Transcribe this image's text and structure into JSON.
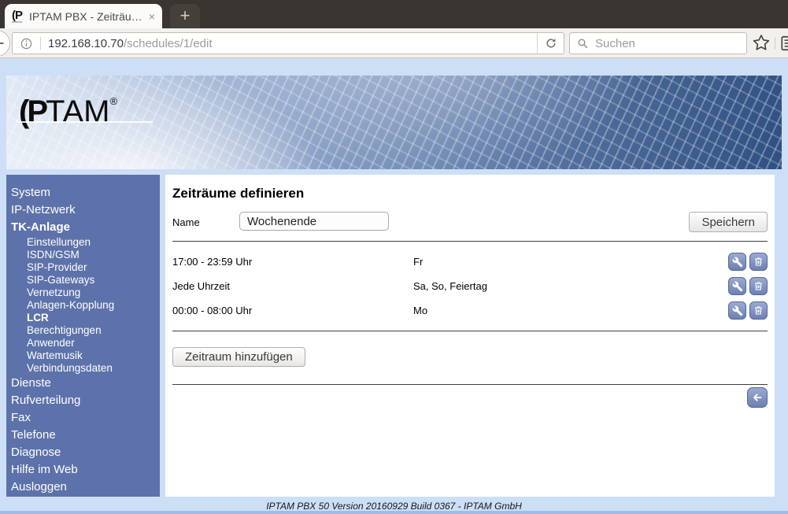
{
  "browser": {
    "tab": {
      "favicon_text": "(P",
      "title": "IPTAM PBX - Zeiträu…",
      "close_glyph": "×",
      "new_tab_glyph": "+"
    },
    "url": {
      "host": "192.168.10.70",
      "path": "/schedules/1/edit"
    },
    "search": {
      "placeholder": "Suchen"
    }
  },
  "banner": {
    "logo_prefix": "(P",
    "logo_rest": "TAM",
    "logo_reg": "®"
  },
  "sidebar": {
    "items": [
      {
        "label": "System",
        "css": "top"
      },
      {
        "label": "IP-Netzwerk",
        "css": "top"
      },
      {
        "label": "TK-Anlage",
        "css": "top bold"
      },
      {
        "label": "Einstellungen",
        "css": "sub"
      },
      {
        "label": "ISDN/GSM",
        "css": "sub"
      },
      {
        "label": "SIP-Provider",
        "css": "sub"
      },
      {
        "label": "SIP-Gateways",
        "css": "sub"
      },
      {
        "label": "Vernetzung",
        "css": "sub"
      },
      {
        "label": "Anlagen-Kopplung",
        "css": "sub"
      },
      {
        "label": "LCR",
        "css": "sub bold"
      },
      {
        "label": "Berechtigungen",
        "css": "sub"
      },
      {
        "label": "Anwender",
        "css": "sub"
      },
      {
        "label": "Wartemusik",
        "css": "sub"
      },
      {
        "label": "Verbindungsdaten",
        "css": "sub"
      },
      {
        "label": "Dienste",
        "css": "top"
      },
      {
        "label": "Rufverteilung",
        "css": "top"
      },
      {
        "label": "Fax",
        "css": "top"
      },
      {
        "label": "Telefone",
        "css": "top"
      },
      {
        "label": "Diagnose",
        "css": "top"
      },
      {
        "label": "Hilfe im Web",
        "css": "top"
      },
      {
        "label": "Ausloggen",
        "css": "top"
      }
    ]
  },
  "main": {
    "title": "Zeiträume definieren",
    "name_label": "Name",
    "name_value": "Wochenende",
    "save_button": "Speichern",
    "add_button": "Zeitraum hinzufügen",
    "rows": [
      {
        "time": "17:00 - 23:59 Uhr",
        "days": "Fr"
      },
      {
        "time": "Jede Uhrzeit",
        "days": "Sa, So, Feiertag"
      },
      {
        "time": "00:00 - 08:00 Uhr",
        "days": "Mo"
      }
    ]
  },
  "footer": {
    "text": "IPTAM PBX 50 Version 20160929 Build 0367 - IPTAM GmbH"
  },
  "colors": {
    "sidebar_blue": "#5d72aa",
    "page_bg": "#cddff6",
    "action_button_blue": "#6c81b3",
    "tabbar_dark": "#3a3531",
    "toolbar_gray": "#f2f0ed"
  }
}
